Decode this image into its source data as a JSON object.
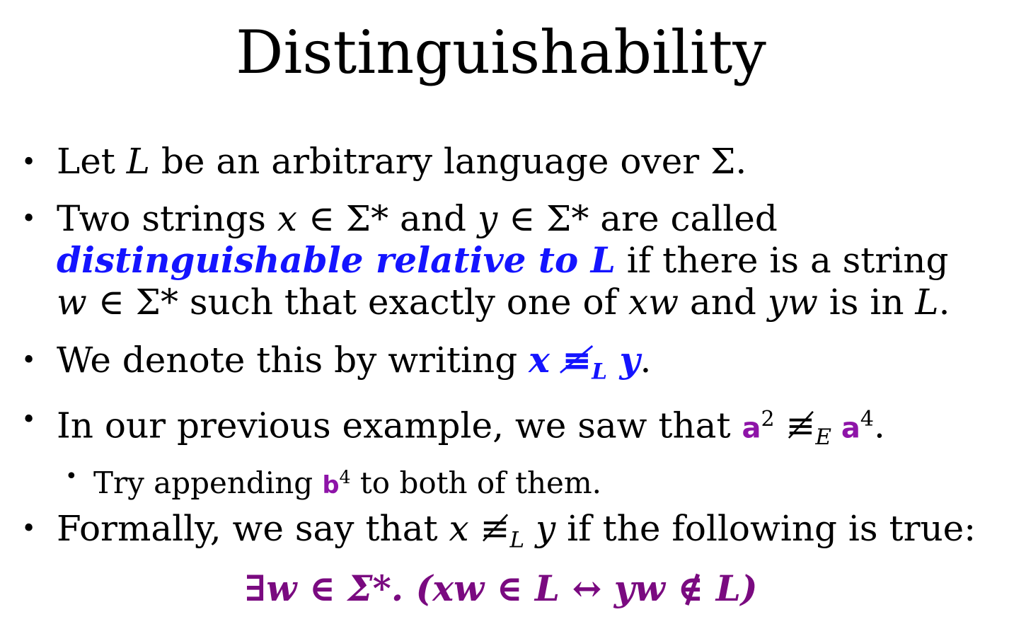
{
  "title": "Distinguishability",
  "bullets": {
    "b1": {
      "p1": "Let ",
      "L": "L",
      "p2": " be an arbitrary language over Σ."
    },
    "b2": {
      "l1_p1": "Two strings ",
      "x": "x",
      "l1_p2": " ∈ Σ* and ",
      "y": "y",
      "l1_p3": " ∈ Σ* are called",
      "term": "distinguishable relative to L",
      "l2_p2": " if there is a string",
      "w": "w",
      "l3_p1": " ∈ Σ* such that exactly one of ",
      "xw": "xw",
      "l3_p2": " and ",
      "yw": "yw",
      "l3_p3": " is in ",
      "L": "L",
      "l3_p4": "."
    },
    "b3": {
      "p1": "We denote this by writing ",
      "notation_x": "x",
      "notation_rel": " ≢",
      "notation_sub": "L",
      "notation_y": " y",
      "p2": "."
    },
    "b4": {
      "p1": "In our previous example, we saw that ",
      "a": "a",
      "exp2": "2",
      "rel": " ≢",
      "sub": "E",
      "a2": " a",
      "exp4": "4",
      "p2": "."
    },
    "sub1": {
      "p1": "Try appending ",
      "b": "b",
      "exp": "4",
      "p2": " to both of them."
    },
    "b5": {
      "p1": "Formally, we say that ",
      "x": "x",
      "rel": " ≢",
      "sub": "L",
      "y": " y",
      "p2": " if the following is true:"
    }
  },
  "formula": "∃w ∈ Σ*. (xw ∈ L ↔ yw ∉ L)"
}
